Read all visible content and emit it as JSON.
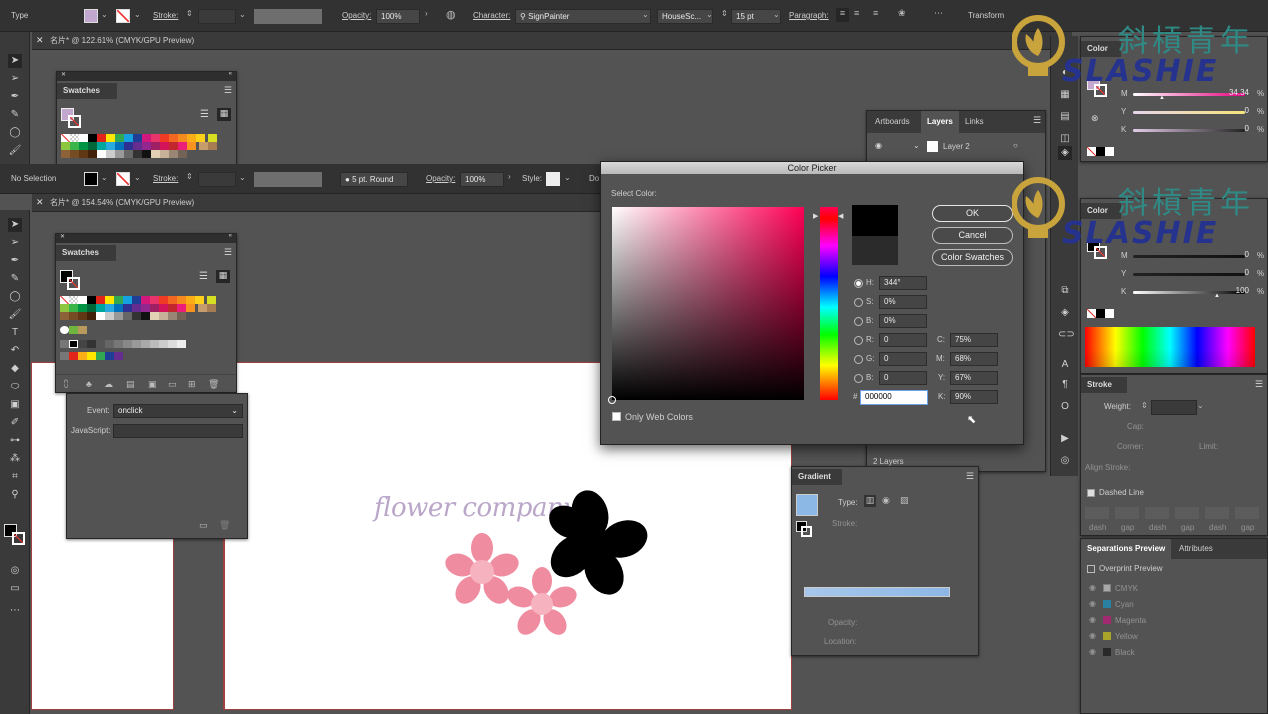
{
  "control_bar_1": {
    "mode": "Type",
    "stroke_label": "Stroke:",
    "opacity_label": "Opacity:",
    "opacity_value": "100%",
    "character_label": "Character:",
    "font_family": "SignPainter",
    "font_style": "HouseSc...",
    "font_size": "15 pt",
    "paragraph_label": "Paragraph:",
    "transform_label": "Transform"
  },
  "doc_tab_1": {
    "title": "名片* @ 122.61% (CMYK/GPU Preview)"
  },
  "swatches_1": {
    "title": "Swatches"
  },
  "control_bar_2": {
    "selection": "No Selection",
    "stroke_label": "Stroke:",
    "brush": "5 pt. Round",
    "opacity_label": "Opacity:",
    "opacity_value": "100%",
    "style_label": "Style:",
    "doc_label": "Do"
  },
  "doc_tab_2": {
    "title": "名片* @ 154.54% (CMYK/GPU Preview)"
  },
  "swatches_2": {
    "title": "Swatches"
  },
  "attributes_panel": {
    "event_label": "Event:",
    "event_value": "onclick",
    "js_label": "JavaScript:"
  },
  "layers_panel": {
    "tabs": [
      "Artboards",
      "Layers",
      "Links"
    ],
    "layer_name": "Layer 2",
    "layer_count": "2 Layers"
  },
  "color_picker": {
    "title": "Color Picker",
    "select_label": "Select Color:",
    "ok": "OK",
    "cancel": "Cancel",
    "swatches_btn": "Color Swatches",
    "h_label": "H:",
    "h_value": "344°",
    "s_label": "S:",
    "s_value": "0%",
    "b_label": "B:",
    "b_value": "0%",
    "r_label": "R:",
    "r_value": "0",
    "g_label": "G:",
    "g_value": "0",
    "bl_label": "B:",
    "bl_value": "0",
    "hex_label": "#",
    "hex_value": "000000",
    "c_label": "C:",
    "c_value": "75%",
    "m_label": "M:",
    "m_value": "68%",
    "y_label": "Y:",
    "y_value": "67%",
    "k_label": "K:",
    "k_value": "90%",
    "web_colors": "Only Web Colors"
  },
  "gradient_panel": {
    "title": "Gradient",
    "type_label": "Type:",
    "stroke_label": "Stroke:",
    "opacity_label": "Opacity:",
    "location_label": "Location:"
  },
  "color_panel_1": {
    "title": "Color",
    "m_label": "M",
    "m_value": "34.34",
    "y_label": "Y",
    "y_value": "0",
    "k_label": "K",
    "k_value": "0",
    "pct": "%"
  },
  "color_panel_2": {
    "title": "Color",
    "m_label": "M",
    "m_value": "0",
    "y_label": "Y",
    "y_value": "0",
    "k_label": "K",
    "k_value": "100",
    "pct": "%"
  },
  "stroke_panel": {
    "title": "Stroke",
    "weight_label": "Weight:",
    "cap_label": "Cap:",
    "corner_label": "Corner:",
    "limit_label": "Limit:",
    "align_label": "Align Stroke:",
    "dashed_label": "Dashed Line",
    "dash_labels": [
      "dash",
      "gap",
      "dash",
      "gap",
      "dash",
      "gap"
    ]
  },
  "separations_panel": {
    "tabs": [
      "Separations Preview",
      "Attributes"
    ],
    "overprint": "Overprint Preview",
    "plates": [
      "CMYK",
      "Cyan",
      "Magenta",
      "Yellow",
      "Black"
    ]
  },
  "watermark": {
    "cn": "斜槓青年",
    "en": "SLASHIE"
  },
  "artwork": {
    "text": "flower company"
  },
  "colors": {
    "bg": "#535353",
    "panel": "#535353",
    "bar": "#323232",
    "flower_pink": "#f08ca0",
    "flower_center": "#f7b2bf",
    "black_flower": "#000000",
    "brand_text": "#b9a6c8",
    "watermark_cn": "#2f8a86",
    "watermark_en": "#25338f"
  }
}
